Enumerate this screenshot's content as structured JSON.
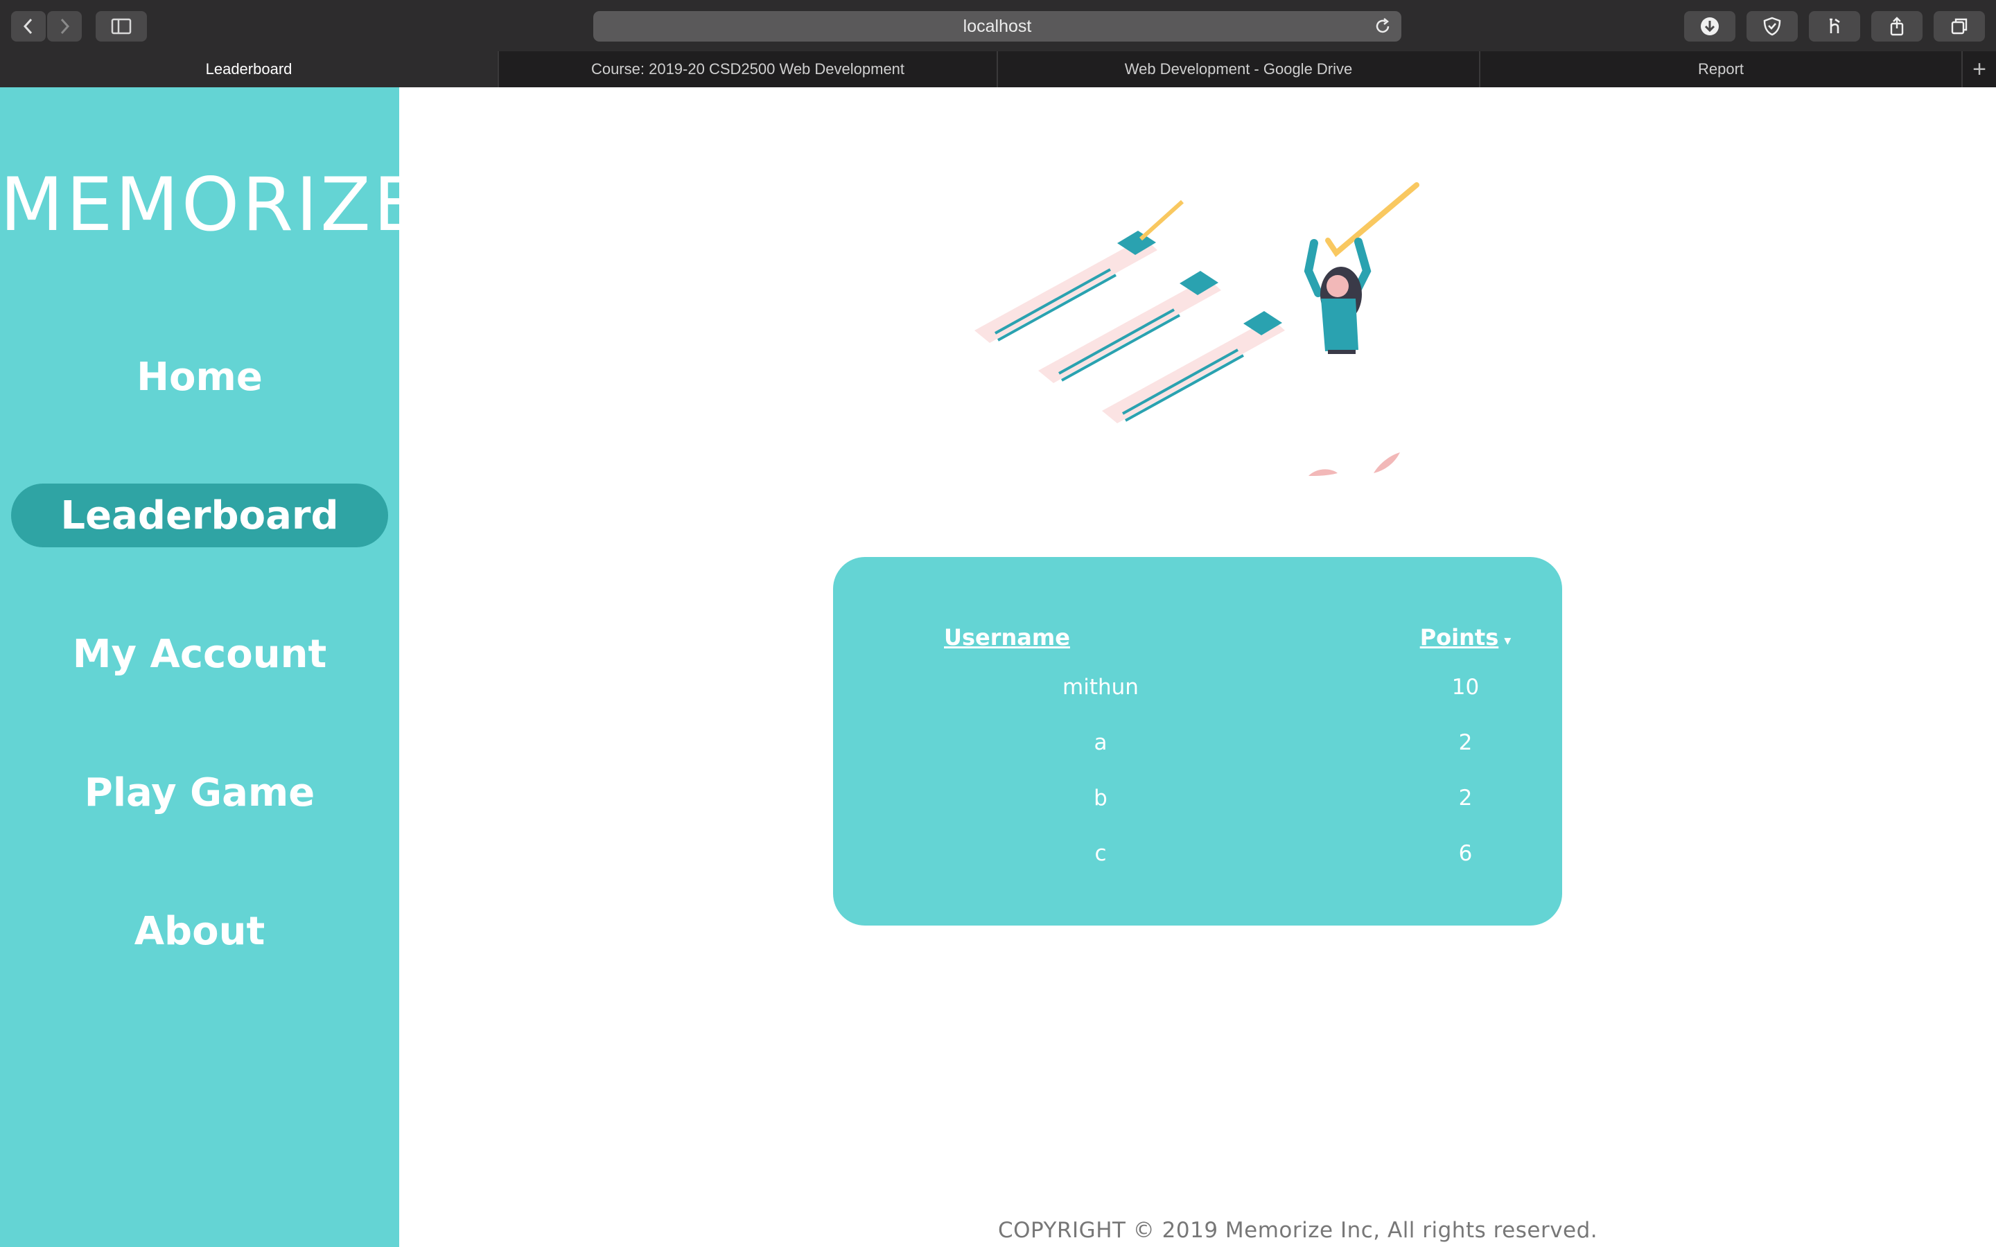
{
  "browser": {
    "url": "localhost",
    "tabs": [
      {
        "label": "Leaderboard",
        "active": true
      },
      {
        "label": "Course: 2019-20 CSD2500 Web Development",
        "active": false
      },
      {
        "label": "Web Development - Google Drive",
        "active": false
      },
      {
        "label": "Report",
        "active": false
      }
    ],
    "new_tab_label": "+"
  },
  "sidebar": {
    "logo": "MEMORIZE",
    "items": [
      {
        "label": "Home"
      },
      {
        "label": "Leaderboard",
        "active": true
      },
      {
        "label": "My Account"
      },
      {
        "label": "Play Game"
      },
      {
        "label": "About"
      }
    ]
  },
  "leaderboard": {
    "headers": {
      "username": "Username",
      "points": "Points",
      "sort_caret": "▾"
    },
    "rows": [
      {
        "username": "mithun",
        "points": "10"
      },
      {
        "username": "a",
        "points": "2"
      },
      {
        "username": "b",
        "points": "2"
      },
      {
        "username": "c",
        "points": "6"
      }
    ]
  },
  "footer": {
    "copyright": "COPYRIGHT © 2019 Memorize Inc, All rights reserved."
  },
  "colors": {
    "accent": "#64d4d4",
    "accent_dark": "#2fa4a4",
    "illustration_teal": "#2aa2b0",
    "illustration_pink": "#fbe3e3",
    "illustration_yellow": "#f9c860"
  }
}
